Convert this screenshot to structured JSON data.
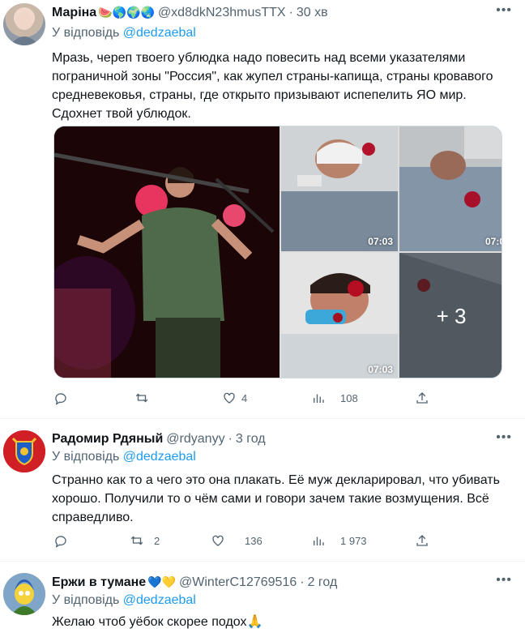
{
  "tweets": [
    {
      "name": "Маріна",
      "emoji": "🍉🌎🌍🌏",
      "handle": "@xd8dkN23hmusTTX",
      "sep": "·",
      "time": "30 хв",
      "reply_prefix": "У відповідь",
      "reply_mention": "@dedzaebal",
      "text": "Мразь, череп твоего ублюдка надо повесить над всеми указателями пограничной зоны \"Россия\", как жупел страны-капища, страны кровавого средневековья, страны, где открыто призывают испепелить ЯО мир. Сдохнет твой ублюдок.",
      "media": {
        "thumb1_time": "07:03",
        "thumb2_time": "07:0",
        "thumb3_time": "07:03",
        "more_count": "+ 3"
      },
      "actions": {
        "reply": "",
        "retweet": "",
        "like": "4",
        "views": "108"
      }
    },
    {
      "name": "Радомир Рдяный",
      "handle": "@rdyanyy",
      "sep": "·",
      "time": "3 год",
      "reply_prefix": "У відповідь",
      "reply_mention": "@dedzaebal",
      "text": "Странно как то а чего это она плакать. Её муж декларировал, что убивать хорошо. Получили то о чём сами и говори зачем такие возмущения. Всё справедливо.",
      "actions": {
        "reply": "",
        "retweet": "2",
        "like": "136",
        "views": "1 973"
      }
    },
    {
      "name": "Ержи в тумане",
      "emoji": "💙💛",
      "handle": "@WinterC12769516",
      "sep": "·",
      "time": "2 год",
      "reply_prefix": "У відповідь",
      "reply_mention": "@dedzaebal",
      "text": "Желаю чтоб уёбок скорее подох🙏"
    }
  ],
  "more_icon": "more-horizontal-icon",
  "colors": {
    "link": "#1d9bf0",
    "muted": "#536471",
    "text": "#0f1419",
    "border": "#eff3f4"
  }
}
